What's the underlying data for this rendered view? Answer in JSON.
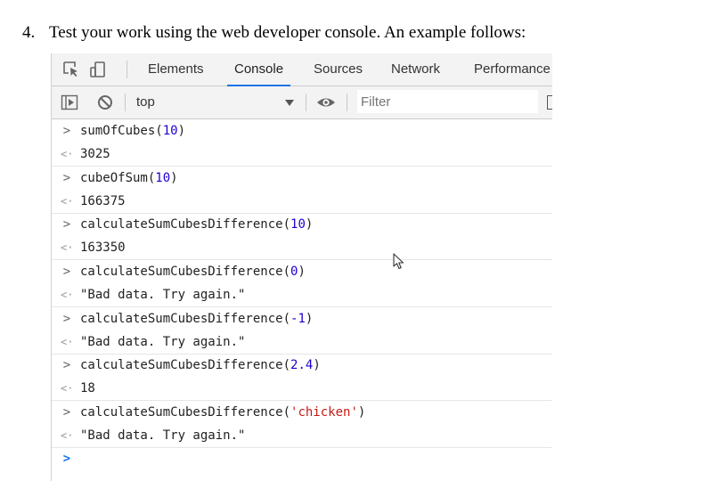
{
  "document": {
    "step_number": "4.",
    "instruction": "Test your work using the web developer console.  An example follows:"
  },
  "devtools": {
    "tabs": [
      {
        "label": "Elements",
        "active": false
      },
      {
        "label": "Console",
        "active": true
      },
      {
        "label": "Sources",
        "active": false
      },
      {
        "label": "Network",
        "active": false
      },
      {
        "label": "Performance",
        "active": false
      }
    ],
    "toolbar": {
      "context": "top",
      "filter_placeholder": "Filter"
    },
    "icons": {
      "inspect": "inspect-element-icon",
      "device": "device-toolbar-icon",
      "sidebar": "show-sidebar-icon",
      "clear": "clear-console-icon",
      "eye": "live-expression-icon"
    },
    "colors": {
      "accent": "#1a73e8",
      "number": "#1c00cf",
      "string": "#c41a16"
    },
    "console": {
      "entries": [
        {
          "input_fn": "sumOfCubes(",
          "input_arg": "10",
          "input_close": ")",
          "arg_type": "num",
          "result": "3025",
          "result_type": "num"
        },
        {
          "input_fn": "cubeOfSum(",
          "input_arg": "10",
          "input_close": ")",
          "arg_type": "num",
          "result": "166375",
          "result_type": "num"
        },
        {
          "input_fn": "calculateSumCubesDifference(",
          "input_arg": "10",
          "input_close": ")",
          "arg_type": "num",
          "result": "163350",
          "result_type": "num"
        },
        {
          "input_fn": "calculateSumCubesDifference(",
          "input_arg": "0",
          "input_close": ")",
          "arg_type": "num",
          "result": "\"Bad data. Try again.\"",
          "result_type": "str"
        },
        {
          "input_fn": "calculateSumCubesDifference(",
          "input_arg": "-1",
          "input_close": ")",
          "arg_type": "num",
          "result": "\"Bad data. Try again.\"",
          "result_type": "str"
        },
        {
          "input_fn": "calculateSumCubesDifference(",
          "input_arg": "2.4",
          "input_close": ")",
          "arg_type": "num",
          "result": "18",
          "result_type": "num"
        },
        {
          "input_fn": "calculateSumCubesDifference(",
          "input_arg": "'chicken'",
          "input_close": ")",
          "arg_type": "str",
          "result": "\"Bad data. Try again.\"",
          "result_type": "str"
        }
      ],
      "input_glyph": ">",
      "output_glyph": "<·"
    }
  }
}
